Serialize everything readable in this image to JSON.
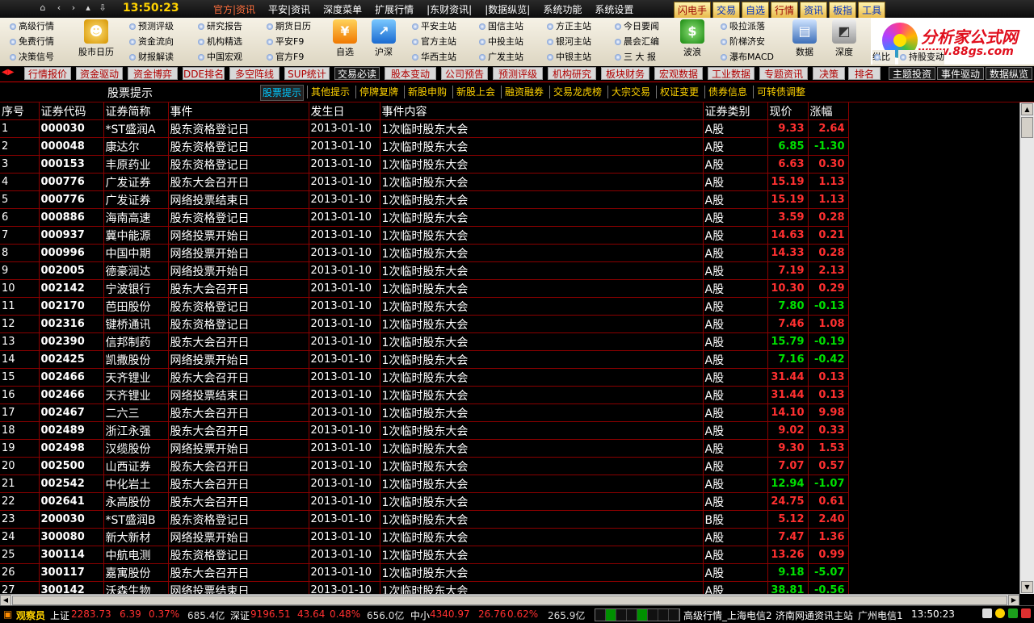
{
  "menubar": {
    "clock": "13:50:23",
    "menus": [
      "官方|资讯",
      "平安|资讯",
      "深度菜单",
      "扩展行情",
      "|东财资讯|",
      "|数据纵览|",
      "系统功能",
      "系统设置"
    ],
    "quick": [
      "闪电手",
      "交易",
      "自选",
      "行情",
      "资讯",
      "板指",
      "工具"
    ]
  },
  "toolbar": {
    "col1": [
      "高级行情",
      "免费行情",
      "决策信号"
    ],
    "big1": "股市日历",
    "col2": [
      "预测评级",
      "资金流向",
      "财报解读"
    ],
    "col3": [
      "研究报告",
      "机构精选",
      "中国宏观"
    ],
    "col4": [
      "期货日历",
      "平安F9",
      "官方F9"
    ],
    "big2": "自选",
    "big3": "沪深",
    "col5": [
      "平安主站",
      "官方主站",
      "华西主站"
    ],
    "col6": [
      "国信主站",
      "中投主站",
      "广发主站"
    ],
    "col7": [
      "方正主站",
      "银河主站",
      "中银主站"
    ],
    "col8": [
      "今日要闻",
      "晨会汇编",
      "三 大 报"
    ],
    "big4": "波浪",
    "col9": [
      "吸拉派落",
      "阶梯济安",
      "瀑布MACD"
    ],
    "big5": "数据",
    "big6": "深度",
    "big7": "纵比",
    "col10": [
      "持股变动"
    ],
    "logo_line1": "分析家公式网",
    "logo_line2": "www.88gs.com"
  },
  "tabs1": [
    "行情报价",
    "资金驱动",
    "资金博弈",
    "DDE排名",
    "多空阵线",
    "SUP统计",
    "交易必读",
    "股本变动",
    "公司预告",
    "预测评级",
    "机构研究",
    "板块财务",
    "宏观数据",
    "工业数据",
    "专题资讯",
    "决策",
    "排名",
    "主题投资",
    "事件驱动",
    "数据纵览"
  ],
  "tabs2": {
    "title": "股票提示",
    "items": [
      "股票提示",
      "其他提示",
      "停牌复牌",
      "新股申购",
      "新股上会",
      "融资融券",
      "交易龙虎榜",
      "大宗交易",
      "权证变更",
      "债券信息",
      "可转债调整"
    ]
  },
  "table": {
    "headers": [
      "序号",
      "证券代码",
      "证券简称",
      "事件",
      "发生日",
      "事件内容",
      "证券类别",
      "现价",
      "涨幅"
    ],
    "rows": [
      [
        "1",
        "000030",
        "*ST盛润A",
        "股东资格登记日",
        "2013-01-10",
        "1次临时股东大会",
        "A股",
        "9.33",
        "2.64"
      ],
      [
        "2",
        "000048",
        "康达尔",
        "股东资格登记日",
        "2013-01-10",
        "1次临时股东大会",
        "A股",
        "6.85",
        "-1.30"
      ],
      [
        "3",
        "000153",
        "丰原药业",
        "股东资格登记日",
        "2013-01-10",
        "1次临时股东大会",
        "A股",
        "6.63",
        "0.30"
      ],
      [
        "4",
        "000776",
        "广发证券",
        "股东大会召开日",
        "2013-01-10",
        "1次临时股东大会",
        "A股",
        "15.19",
        "1.13"
      ],
      [
        "5",
        "000776",
        "广发证券",
        "网络投票结束日",
        "2013-01-10",
        "1次临时股东大会",
        "A股",
        "15.19",
        "1.13"
      ],
      [
        "6",
        "000886",
        "海南高速",
        "股东资格登记日",
        "2013-01-10",
        "1次临时股东大会",
        "A股",
        "3.59",
        "0.28"
      ],
      [
        "7",
        "000937",
        "冀中能源",
        "网络投票开始日",
        "2013-01-10",
        "1次临时股东大会",
        "A股",
        "14.63",
        "0.21"
      ],
      [
        "8",
        "000996",
        "中国中期",
        "网络投票开始日",
        "2013-01-10",
        "1次临时股东大会",
        "A股",
        "14.33",
        "0.28"
      ],
      [
        "9",
        "002005",
        "德豪润达",
        "网络投票开始日",
        "2013-01-10",
        "1次临时股东大会",
        "A股",
        "7.19",
        "2.13"
      ],
      [
        "10",
        "002142",
        "宁波银行",
        "股东大会召开日",
        "2013-01-10",
        "1次临时股东大会",
        "A股",
        "10.30",
        "0.29"
      ],
      [
        "11",
        "002170",
        "芭田股份",
        "股东资格登记日",
        "2013-01-10",
        "1次临时股东大会",
        "A股",
        "7.80",
        "-0.13"
      ],
      [
        "12",
        "002316",
        "键桥通讯",
        "股东资格登记日",
        "2013-01-10",
        "1次临时股东大会",
        "A股",
        "7.46",
        "1.08"
      ],
      [
        "13",
        "002390",
        "信邦制药",
        "股东大会召开日",
        "2013-01-10",
        "1次临时股东大会",
        "A股",
        "15.79",
        "-0.19"
      ],
      [
        "14",
        "002425",
        "凯撒股份",
        "网络投票开始日",
        "2013-01-10",
        "1次临时股东大会",
        "A股",
        "7.16",
        "-0.42"
      ],
      [
        "15",
        "002466",
        "天齐锂业",
        "股东大会召开日",
        "2013-01-10",
        "1次临时股东大会",
        "A股",
        "31.44",
        "0.13"
      ],
      [
        "16",
        "002466",
        "天齐锂业",
        "网络投票结束日",
        "2013-01-10",
        "1次临时股东大会",
        "A股",
        "31.44",
        "0.13"
      ],
      [
        "17",
        "002467",
        "二六三",
        "股东大会召开日",
        "2013-01-10",
        "1次临时股东大会",
        "A股",
        "14.10",
        "9.98"
      ],
      [
        "18",
        "002489",
        "浙江永强",
        "股东大会召开日",
        "2013-01-10",
        "1次临时股东大会",
        "A股",
        "9.02",
        "0.33"
      ],
      [
        "19",
        "002498",
        "汉缆股份",
        "网络投票开始日",
        "2013-01-10",
        "1次临时股东大会",
        "A股",
        "9.30",
        "1.53"
      ],
      [
        "20",
        "002500",
        "山西证券",
        "股东大会召开日",
        "2013-01-10",
        "1次临时股东大会",
        "A股",
        "7.07",
        "0.57"
      ],
      [
        "21",
        "002542",
        "中化岩土",
        "股东大会召开日",
        "2013-01-10",
        "1次临时股东大会",
        "A股",
        "12.94",
        "-1.07"
      ],
      [
        "22",
        "002641",
        "永高股份",
        "股东大会召开日",
        "2013-01-10",
        "1次临时股东大会",
        "A股",
        "24.75",
        "0.61"
      ],
      [
        "23",
        "200030",
        "*ST盛润B",
        "股东资格登记日",
        "2013-01-10",
        "1次临时股东大会",
        "B股",
        "5.12",
        "2.40"
      ],
      [
        "24",
        "300080",
        "新大新材",
        "网络投票开始日",
        "2013-01-10",
        "1次临时股东大会",
        "A股",
        "7.47",
        "1.36"
      ],
      [
        "25",
        "300114",
        "中航电测",
        "股东资格登记日",
        "2013-01-10",
        "1次临时股东大会",
        "A股",
        "13.26",
        "0.99"
      ],
      [
        "26",
        "300117",
        "嘉寓股份",
        "股东大会召开日",
        "2013-01-10",
        "1次临时股东大会",
        "A股",
        "9.18",
        "-5.07"
      ],
      [
        "27",
        "300142",
        "沃森生物",
        "网络投票结束日",
        "2013-01-10",
        "1次临时股东大会",
        "A股",
        "38.81",
        "-0.56"
      ]
    ]
  },
  "status": {
    "user": "观察员",
    "sh_label": "上证",
    "sh_index": "2283.73",
    "sh_change": "6.39",
    "sh_pct": "0.37%",
    "sh_amount": "685.4亿",
    "sz_label": "深证",
    "sz_index": "9196.51",
    "sz_change": "43.64",
    "sz_pct": "0.48%",
    "sz_amount": "656.0亿",
    "zx_label": "中小",
    "zx_index": "4340.97",
    "zx_change": "26.76",
    "zx_pct": "0.62%",
    "zx_amount": "265.9亿",
    "server1": "高级行情_上海电信2",
    "server2": "济南网通资讯主站",
    "server3": "广州电信1",
    "time": "13:50:23"
  },
  "colors": {
    "up": "#ff3030",
    "down": "#00e000",
    "grid_line": "#8b0000",
    "accent": "#ffd200"
  }
}
